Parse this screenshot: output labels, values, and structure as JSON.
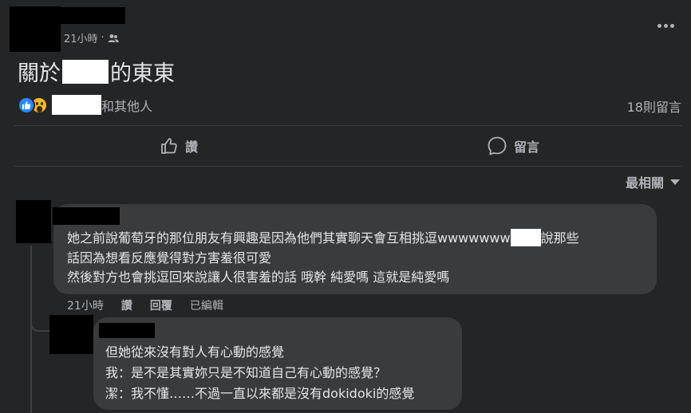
{
  "post": {
    "time": "21小時",
    "separator": "·",
    "audience_icon": "friends-icon",
    "title_prefix": "關於",
    "title_suffix": "的東東",
    "more_icon": "more-dots-icon"
  },
  "reactions": {
    "icons": [
      "like-icon",
      "wow-icon"
    ],
    "others_text": "和其他人",
    "comment_count": "18則留言"
  },
  "actions": {
    "like_label": "讚",
    "comment_label": "留言"
  },
  "sort": {
    "label": "最相關"
  },
  "comments": [
    {
      "lines": [
        {
          "before": "她之前說葡萄牙的那位朋友有興趣是因為他們其實聊天會互相挑逗wwwwwww",
          "after": "說那些"
        },
        "話因為想看反應覺得對方害羞很可愛",
        "然後對方也會挑逗回來說讓人很害羞的話 哦幹 純愛嗎 這就是純愛嗎"
      ],
      "time": "21小時",
      "like": "讚",
      "reply": "回覆",
      "edited": "已編輯"
    },
    {
      "lines": [
        "但她從來沒有對人有心動的感覺",
        "我：是不是其實妳只是不知道自己有心動的感覺？",
        "潔：我不懂……不過一直以來都是沒有dokidoki的感覺"
      ]
    }
  ],
  "colors": {
    "background": "#242526",
    "bubble": "#3a3b3c",
    "text_primary": "#e4e6eb",
    "text_secondary": "#b0b3b8",
    "like_blue": "#2d88ff",
    "wow_yellow": "#f7b928"
  }
}
